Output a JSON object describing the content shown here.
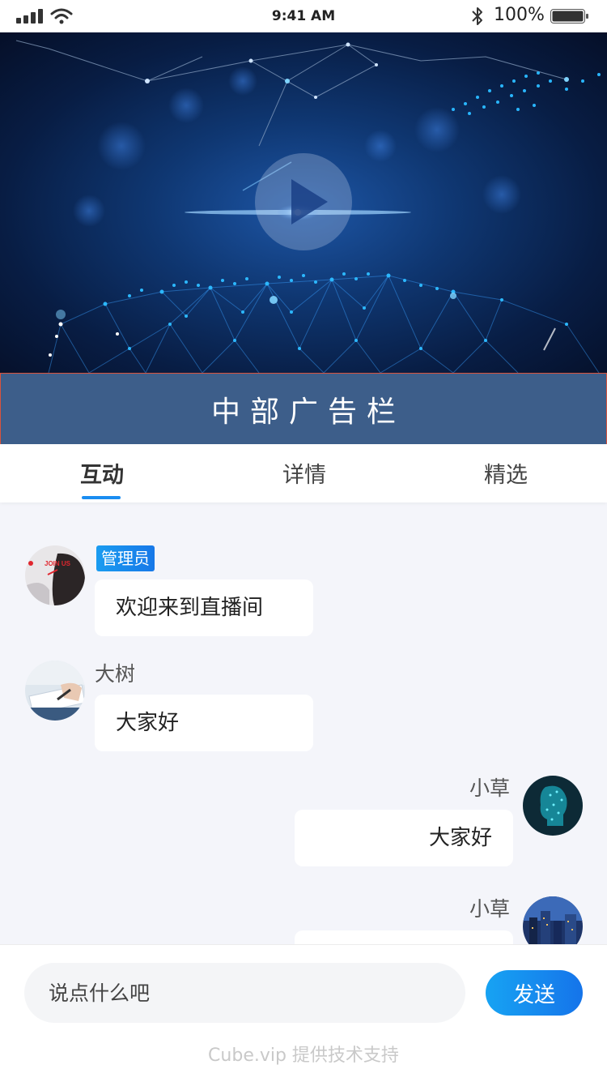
{
  "status_bar": {
    "time": "9:41 AM",
    "battery": "100%",
    "icons": [
      "signal-icon",
      "wifi-icon",
      "bluetooth-icon",
      "battery-icon"
    ]
  },
  "video": {
    "play_icon": "play-icon"
  },
  "ad_banner": {
    "label": "中部广告栏",
    "background": "#3d5e8a",
    "border": "#d9533c"
  },
  "tabs": {
    "items": [
      {
        "label": "互动",
        "active": true
      },
      {
        "label": "详情",
        "active": false
      },
      {
        "label": "精选",
        "active": false
      }
    ],
    "accent": "#1a8df1"
  },
  "chat": {
    "messages": [
      {
        "side": "left",
        "sender": "管理员",
        "is_admin": true,
        "text": "欢迎来到直播间",
        "avatar_text": "JOIN US"
      },
      {
        "side": "left",
        "sender": "大树",
        "is_admin": false,
        "text": "大家好"
      },
      {
        "side": "right",
        "sender": "小草",
        "is_admin": false,
        "text": "大家好"
      },
      {
        "side": "right",
        "sender": "小草",
        "is_admin": false,
        "text": ""
      }
    ]
  },
  "input_bar": {
    "placeholder": "说点什么吧",
    "send_label": "发送",
    "powered_by": "Cube.vip 提供技术支持"
  }
}
